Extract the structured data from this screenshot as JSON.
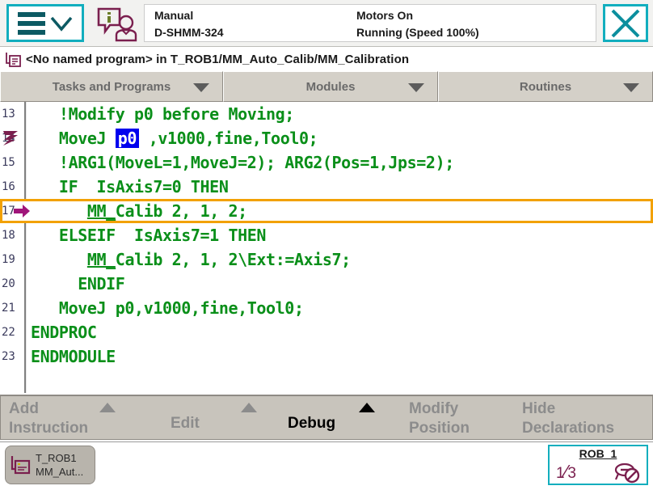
{
  "topbar": {
    "menu_icon": "hamburger-menu-icon",
    "chevron_icon": "chevron-down-icon",
    "operator_icon": "operator-info-icon",
    "status_mode": "Manual",
    "status_controller": "D-SHMM-324",
    "status_motors": "Motors On",
    "status_running": "Running (Speed 100%)",
    "quickset_icon": "quickset-menu-icon",
    "close_icon": "close-icon"
  },
  "breadcrumb": {
    "icon": "program-module-icon",
    "text": "<No named program> in T_ROB1/MM_Auto_Calib/MM_Calibration"
  },
  "dropdowns": [
    {
      "label": "Tasks and Programs"
    },
    {
      "label": "Modules"
    },
    {
      "label": "Routines"
    }
  ],
  "code": {
    "lines": [
      {
        "num": "13",
        "text": "   !Modify p0 before Moving;"
      },
      {
        "num": "14",
        "pre": "   MoveJ ",
        "sel": "p0",
        "post": " ,v1000,fine,Tool0;",
        "pointer": "program-pointer-icon"
      },
      {
        "num": "15",
        "text": "   !ARG1(MoveL=1,MoveJ=2); ARG2(Pos=1,Jps=2);"
      },
      {
        "num": "16",
        "text": "   IF  IsAxis7=0 THEN"
      },
      {
        "num": "17",
        "under": "MM_",
        "post": "Calib 2, 1, 2;",
        "indent": "      ",
        "selected": true,
        "pointer": "motion-pointer-icon"
      },
      {
        "num": "18",
        "text": "   ELSEIF  IsAxis7=1 THEN"
      },
      {
        "num": "19",
        "under": "MM_",
        "post": "Calib 2, 1, 2\\Ext:=Axis7;",
        "indent": "      "
      },
      {
        "num": "20",
        "text": "     ENDIF"
      },
      {
        "num": "21",
        "text": "   MoveJ p0,v1000,fine,Tool0;"
      },
      {
        "num": "22",
        "text": "ENDPROC"
      },
      {
        "num": "23",
        "text": "ENDMODULE"
      }
    ]
  },
  "actions": [
    {
      "label": "Add\nInstruction",
      "enabled": false,
      "has_arrow": true
    },
    {
      "label": "Edit",
      "enabled": false,
      "has_arrow": true
    },
    {
      "label": "Debug",
      "enabled": true,
      "has_arrow": true
    },
    {
      "label": "Modify\nPosition",
      "enabled": false,
      "has_arrow": false
    },
    {
      "label": "Hide\nDeclarations",
      "enabled": false,
      "has_arrow": false
    }
  ],
  "taskbar": {
    "task_icon": "program-editor-icon",
    "task_label": "T_ROB1\nMM_Aut...",
    "rob_title": "ROB_1",
    "rob_numerator": "1",
    "rob_denominator": "3",
    "jog_icon": "jog-axis-disabled-icon"
  },
  "colors": {
    "accent_teal": "#12aebe",
    "code_green": "#0a8f19",
    "selection_orange": "#f2a104",
    "token_blue": "#0000ee",
    "pointer_magenta": "#7a1f4e"
  }
}
